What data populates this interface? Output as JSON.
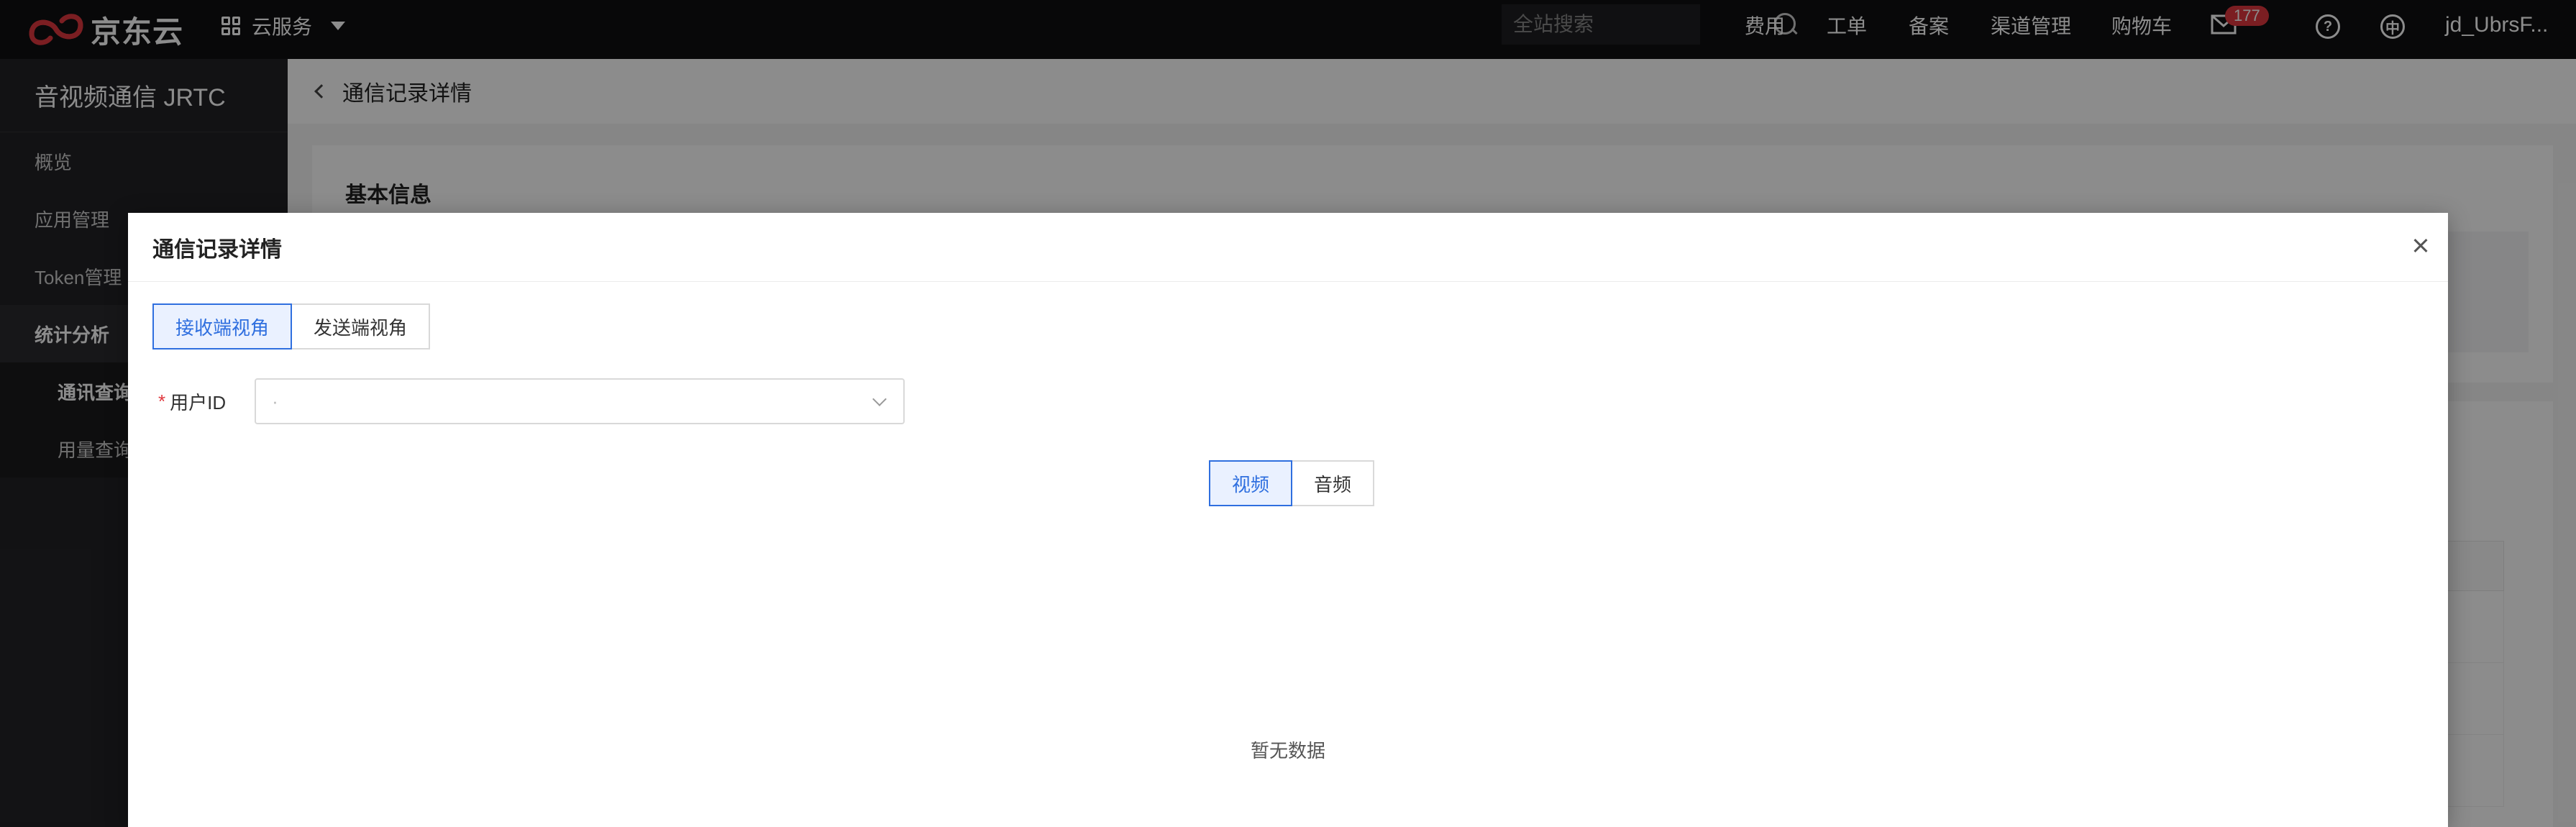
{
  "topnav": {
    "logo_text": "京东云",
    "cloud_service": "云服务",
    "search_placeholder": "全站搜索",
    "links": [
      "费用",
      "工单",
      "备案",
      "渠道管理",
      "购物车"
    ],
    "mail_badge": "177",
    "user": "jd_UbrsF..."
  },
  "sidebar": {
    "title": "音视频通信 JRTC",
    "items": [
      "概览",
      "应用管理",
      "Token管理"
    ],
    "group": "统计分析",
    "subitems": [
      "通讯查询",
      "用量查询"
    ]
  },
  "main": {
    "header_title": "通信记录详情",
    "basic_info": "基本信息"
  },
  "modal": {
    "title": "通信记录详情",
    "tabs": [
      "接收端视角",
      "发送端视角"
    ],
    "user_id_label": "用户ID",
    "user_id_value": "·",
    "media": [
      "视频",
      "音频"
    ],
    "empty_text": "暂无数据"
  },
  "colors": {
    "accent": "#2f6fdf",
    "required": "#e0383e",
    "topbar": "#0f0f12",
    "sidebar": "#222226"
  }
}
